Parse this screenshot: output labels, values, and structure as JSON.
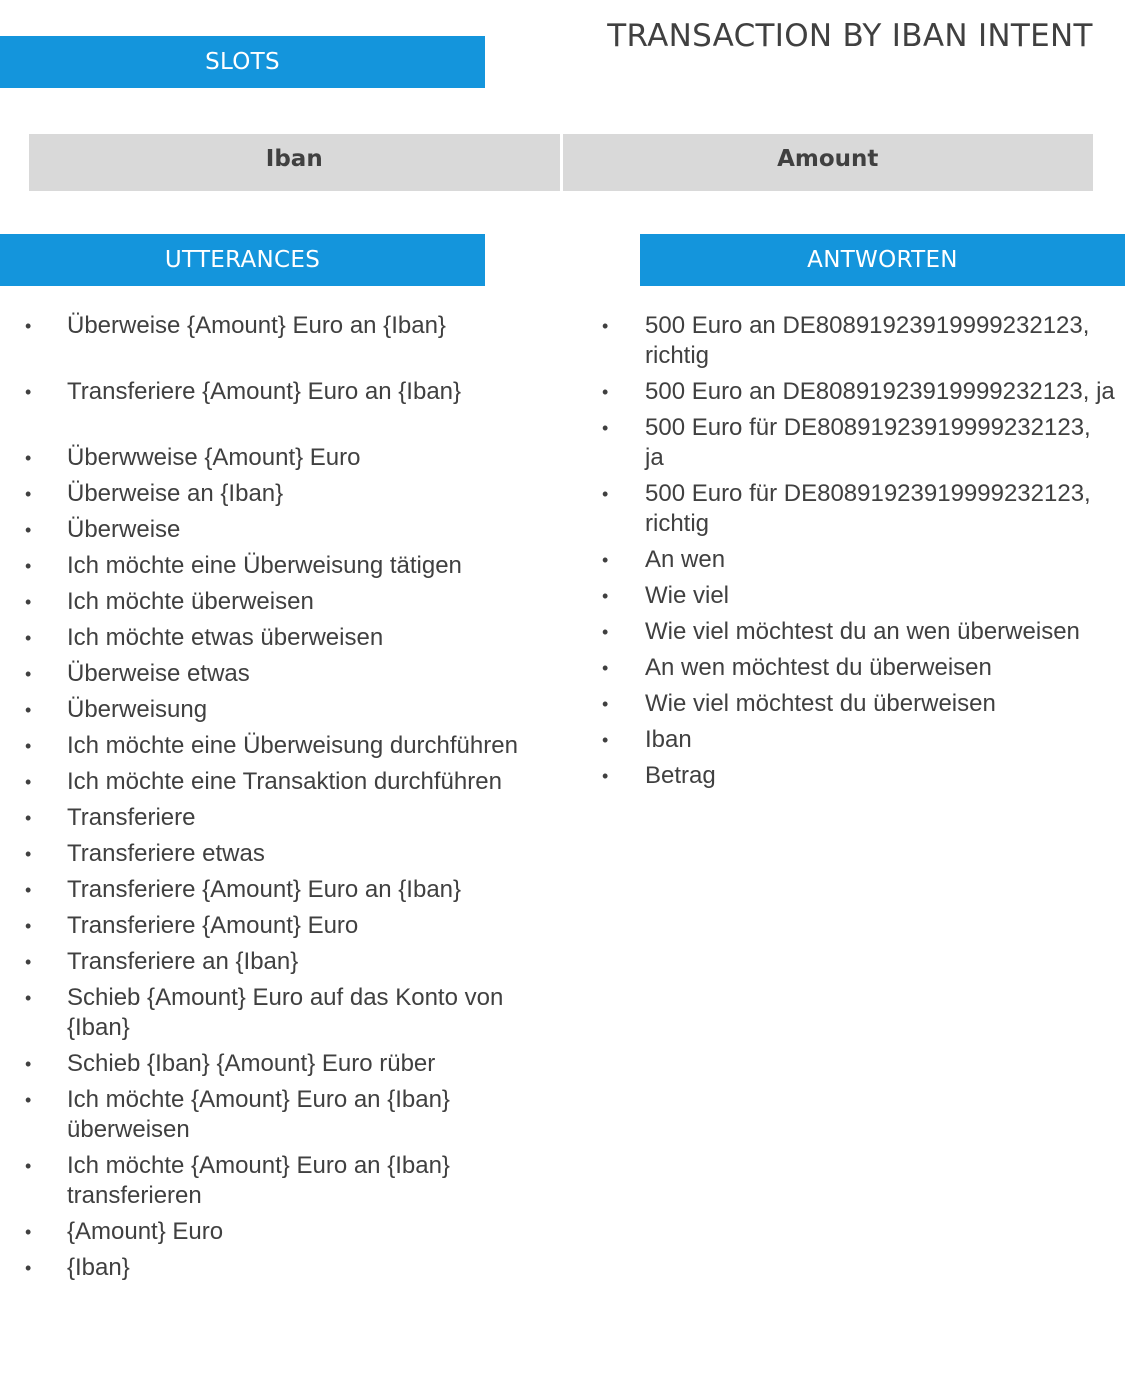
{
  "title": "TRANSACTION BY IBAN INTENT",
  "slots": {
    "header": "SLOTS",
    "columns": [
      "Iban",
      "Amount"
    ]
  },
  "utterances": {
    "header": "UTTERANCES",
    "items": [
      "Überweise {Amount} Euro an {Iban}",
      "Transferiere {Amount} Euro an {Iban}",
      "Überwweise {Amount} Euro",
      "Überweise an {Iban}",
      "Überweise",
      "Ich möchte eine Überweisung tätigen",
      "Ich möchte überweisen",
      "Ich möchte etwas überweisen",
      "Überweise etwas",
      "Überweisung",
      "Ich möchte eine Überweisung durchführen",
      "Ich möchte eine Transaktion durchführen",
      "Transferiere",
      "Transferiere etwas",
      "Transferiere {Amount} Euro an {Iban}",
      "Transferiere {Amount} Euro",
      "Transferiere an {Iban}",
      "Schieb {Amount} Euro auf das Konto von {Iban}",
      "Schieb {Iban} {Amount} Euro rüber",
      "Ich möchte {Amount} Euro an {Iban} überweisen",
      "Ich möchte {Amount} Euro an {Iban} transferieren",
      "{Amount} Euro",
      "{Iban}"
    ]
  },
  "antworten": {
    "header": "ANTWORTEN",
    "items": [
      "500 Euro an DE80891923919999232123, richtig",
      "500 Euro an DE80891923919999232123, ja",
      "500 Euro für DE80891923919999232123, ja",
      "500 Euro für DE80891923919999232123, richtig",
      "An wen",
      "Wie viel",
      "Wie viel möchtest du an wen überweisen",
      "An wen möchtest du überweisen",
      "Wie viel möchtest du überweisen",
      "Iban",
      "Betrag"
    ]
  }
}
